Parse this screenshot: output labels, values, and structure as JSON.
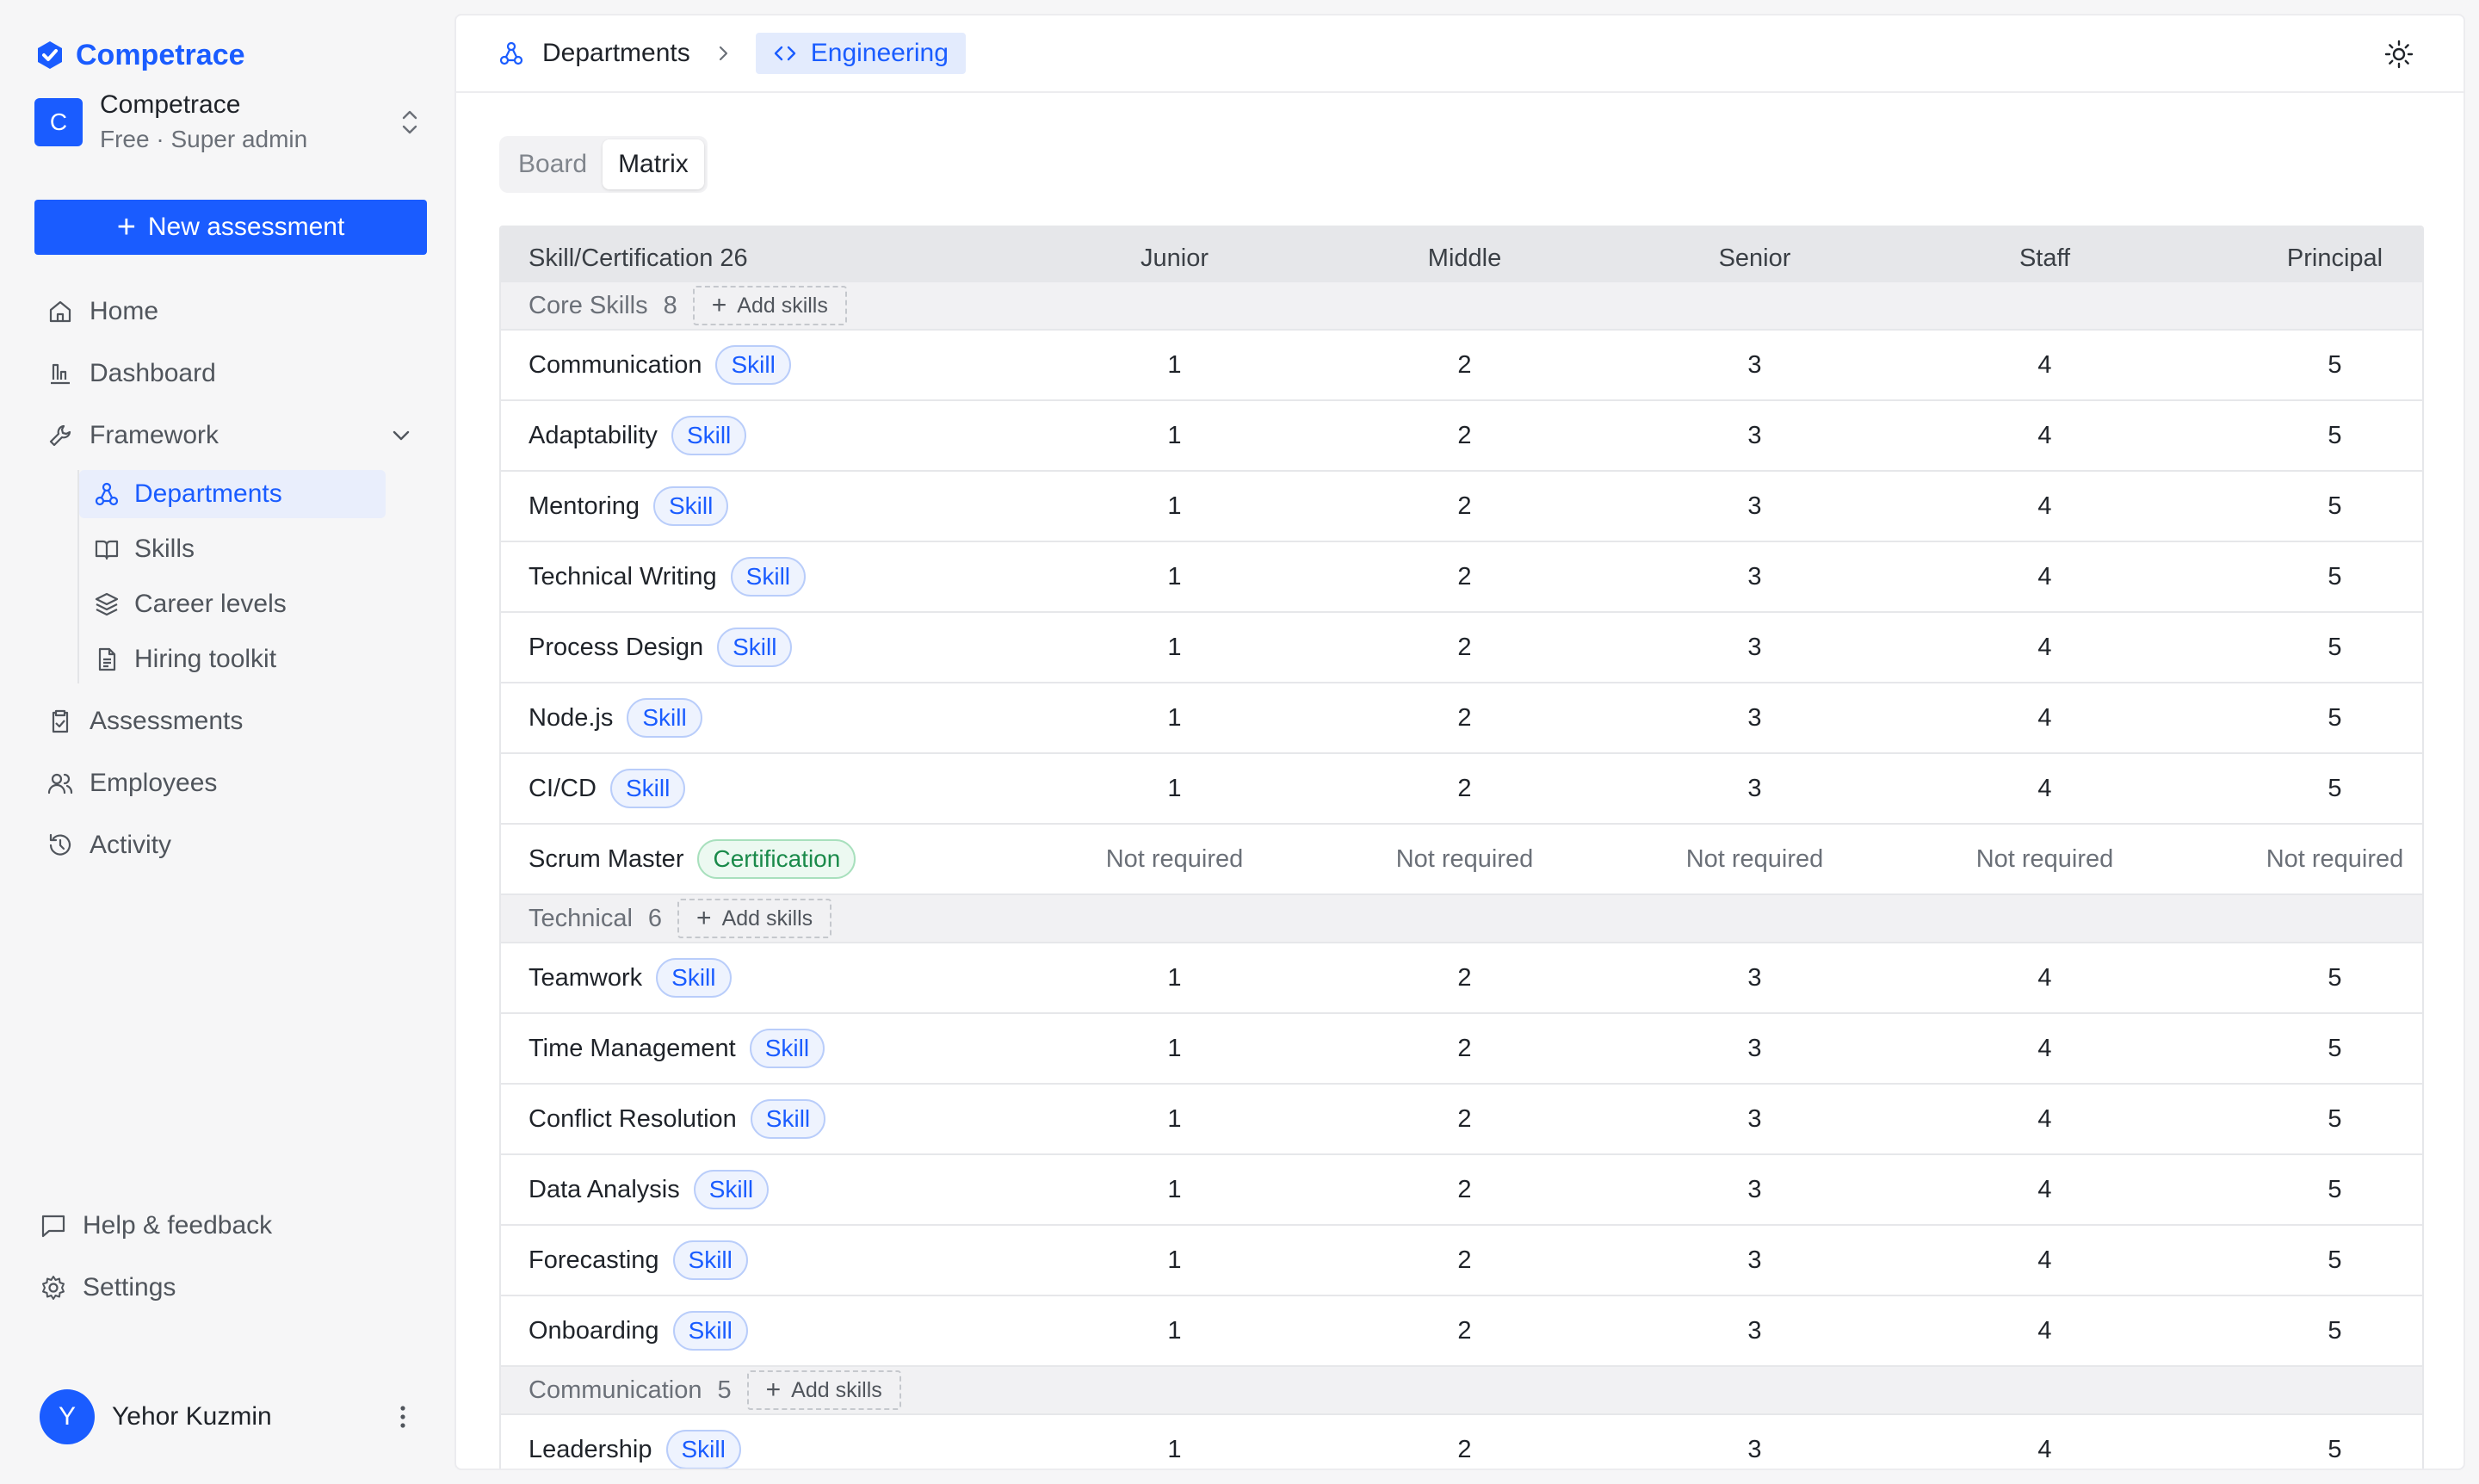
{
  "app": {
    "brand": "Competrace",
    "org_name": "Competrace",
    "org_plan": "Free · Super admin",
    "org_initial": "C",
    "new_assessment": "New assessment"
  },
  "nav": {
    "home": "Home",
    "dashboard": "Dashboard",
    "framework": "Framework",
    "departments": "Departments",
    "skills": "Skills",
    "career_levels": "Career levels",
    "hiring_toolkit": "Hiring toolkit",
    "assessments": "Assessments",
    "employees": "Employees",
    "activity": "Activity",
    "help": "Help & feedback",
    "settings": "Settings"
  },
  "user": {
    "initial": "Y",
    "name": "Yehor Kuzmin"
  },
  "breadcrumb": {
    "root": "Departments",
    "current": "Engineering"
  },
  "views": {
    "board": "Board",
    "matrix": "Matrix"
  },
  "table": {
    "header": {
      "name": "Skill/Certification 26",
      "levels": [
        "Junior",
        "Middle",
        "Senior",
        "Staff",
        "Principal"
      ]
    },
    "add_skills": "Add skills",
    "groups": [
      {
        "name": "Core Skills",
        "count": "8",
        "rows": [
          {
            "name": "Communication",
            "type": "Skill",
            "levels": [
              "1",
              "2",
              "3",
              "4",
              "5"
            ]
          },
          {
            "name": "Adaptability",
            "type": "Skill",
            "levels": [
              "1",
              "2",
              "3",
              "4",
              "5"
            ]
          },
          {
            "name": "Mentoring",
            "type": "Skill",
            "levels": [
              "1",
              "2",
              "3",
              "4",
              "5"
            ]
          },
          {
            "name": "Technical Writing",
            "type": "Skill",
            "levels": [
              "1",
              "2",
              "3",
              "4",
              "5"
            ]
          },
          {
            "name": "Process Design",
            "type": "Skill",
            "levels": [
              "1",
              "2",
              "3",
              "4",
              "5"
            ]
          },
          {
            "name": "Node.js",
            "type": "Skill",
            "levels": [
              "1",
              "2",
              "3",
              "4",
              "5"
            ]
          },
          {
            "name": "CI/CD",
            "type": "Skill",
            "levels": [
              "1",
              "2",
              "3",
              "4",
              "5"
            ]
          },
          {
            "name": "Scrum Master",
            "type": "Certification",
            "levels": [
              "Not required",
              "Not required",
              "Not required",
              "Not required",
              "Not required"
            ]
          }
        ]
      },
      {
        "name": "Technical",
        "count": "6",
        "rows": [
          {
            "name": "Teamwork",
            "type": "Skill",
            "levels": [
              "1",
              "2",
              "3",
              "4",
              "5"
            ]
          },
          {
            "name": "Time Management",
            "type": "Skill",
            "levels": [
              "1",
              "2",
              "3",
              "4",
              "5"
            ]
          },
          {
            "name": "Conflict Resolution",
            "type": "Skill",
            "levels": [
              "1",
              "2",
              "3",
              "4",
              "5"
            ]
          },
          {
            "name": "Data Analysis",
            "type": "Skill",
            "levels": [
              "1",
              "2",
              "3",
              "4",
              "5"
            ]
          },
          {
            "name": "Forecasting",
            "type": "Skill",
            "levels": [
              "1",
              "2",
              "3",
              "4",
              "5"
            ]
          },
          {
            "name": "Onboarding",
            "type": "Skill",
            "levels": [
              "1",
              "2",
              "3",
              "4",
              "5"
            ]
          }
        ]
      },
      {
        "name": "Communication",
        "count": "5",
        "rows": [
          {
            "name": "Leadership",
            "type": "Skill",
            "levels": [
              "1",
              "2",
              "3",
              "4",
              "5"
            ]
          }
        ]
      }
    ]
  }
}
